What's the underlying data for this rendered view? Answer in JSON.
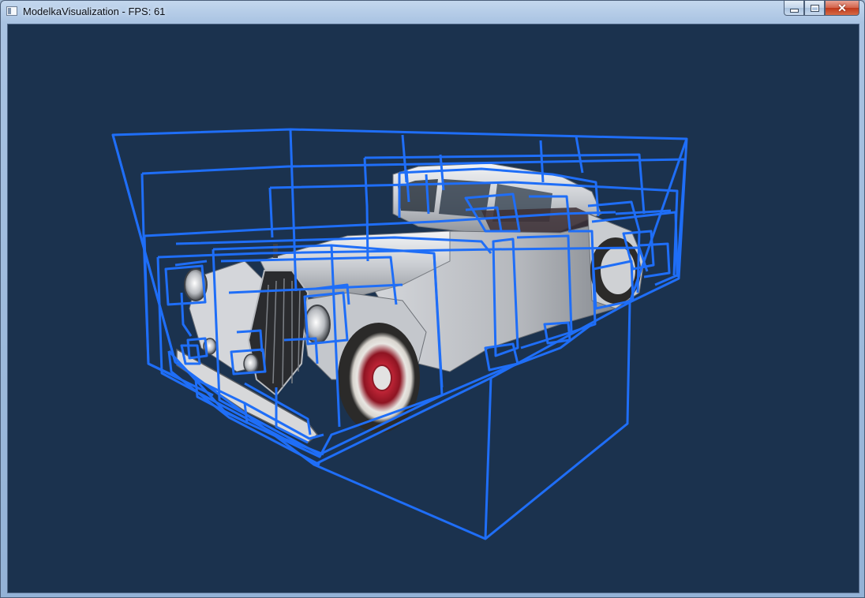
{
  "window": {
    "title": "ModelkaVisualization - FPS: 61",
    "buttons": {
      "minimize": "minimize",
      "maximize": "maximize",
      "close": "close"
    }
  },
  "viewport": {
    "background_color": "#1b324e",
    "wireframe_color": "#1f6ef7",
    "model": "vintage-car"
  }
}
